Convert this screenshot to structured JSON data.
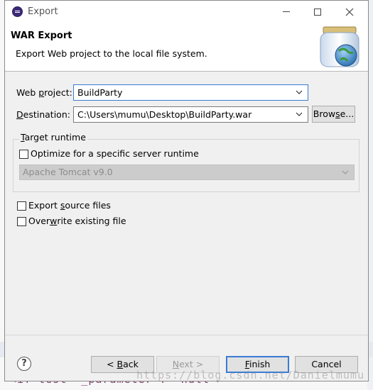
{
  "window": {
    "title": "Export"
  },
  "wizard": {
    "title": "WAR Export",
    "description": "Export Web project to the local file system."
  },
  "form": {
    "web_project": {
      "label_pre": "Web ",
      "label_u": "p",
      "label_post": "roject:",
      "value": "BuildParty"
    },
    "destination": {
      "label_pre": "",
      "label_u": "D",
      "label_post": "estination:",
      "value": "C:\\Users\\mumu\\Desktop\\BuildParty.war"
    },
    "browse": {
      "label_pre": "Brow",
      "label_u": "s",
      "label_post": "e..."
    }
  },
  "target_runtime": {
    "legend_pre": "",
    "legend_u": "T",
    "legend_post": "arget runtime",
    "optimize_label": "Optimize for a specific server runtime",
    "optimize_checked": false,
    "server_value": "Apache Tomcat v9.0"
  },
  "options": {
    "export_source": {
      "label_pre": "Export ",
      "label_u": "s",
      "label_post": "ource files",
      "checked": false
    },
    "overwrite": {
      "label_pre": "Over",
      "label_u": "w",
      "label_post": "rite existing file",
      "checked": false
    }
  },
  "buttons": {
    "back": {
      "label_pre": "< ",
      "label_u": "B",
      "label_post": "ack"
    },
    "next": {
      "label_pre": "",
      "label_u": "N",
      "label_post": "ext >"
    },
    "finish": {
      "label_pre": "",
      "label_u": "F",
      "label_post": "inish"
    },
    "cancel": "Cancel"
  },
  "background": {
    "code_line": "<if test=\"_parameter != null\">",
    "watermark": "https://blog.csdn.net/Danielmumu"
  },
  "colors": {
    "accent": "#3a7bd5",
    "dialog_bg": "#f0f0f0"
  }
}
